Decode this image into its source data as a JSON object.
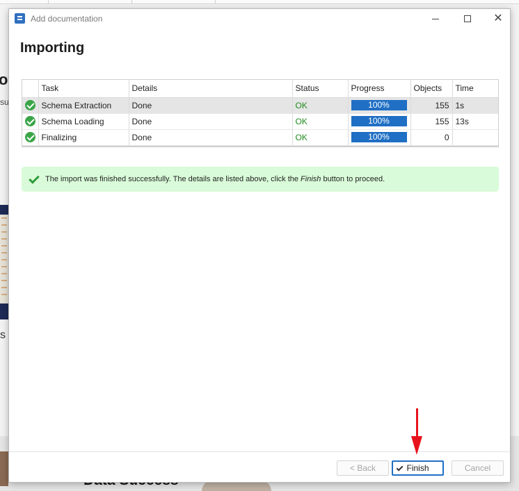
{
  "window": {
    "title": "Add documentation",
    "icon": "document-app-icon"
  },
  "page": {
    "heading": "Importing"
  },
  "table": {
    "headers": [
      "",
      "Task",
      "Details",
      "Status",
      "Progress",
      "Objects",
      "Time"
    ],
    "rows": [
      {
        "task": "Schema Extraction",
        "details": "Done",
        "status": "OK",
        "progress": "100%",
        "progress_value": 1.0,
        "objects": "155",
        "time": "1s"
      },
      {
        "task": "Schema Loading",
        "details": "Done",
        "status": "OK",
        "progress": "100%",
        "progress_value": 1.0,
        "objects": "155",
        "time": "13s"
      },
      {
        "task": "Finalizing",
        "details": "Done",
        "status": "OK",
        "progress": "100%",
        "progress_value": 1.0,
        "objects": "0",
        "time": ""
      }
    ]
  },
  "message": {
    "before": "The import was finished successfully. The details are listed above, click the ",
    "emphasis": "Finish",
    "after": " button to proceed."
  },
  "buttons": {
    "back": "< Back",
    "finish": "Finish",
    "cancel": "Cancel"
  },
  "background": {
    "fragment_of": "of",
    "fragment_su": "su",
    "fragment_s": "s",
    "fragment_bottom": "Data Success"
  },
  "colors": {
    "accent": "#1f6fc4",
    "ok": "#1e8a1e",
    "success_bg": "#d9fbd9",
    "annotation_arrow": "#e8121c"
  }
}
